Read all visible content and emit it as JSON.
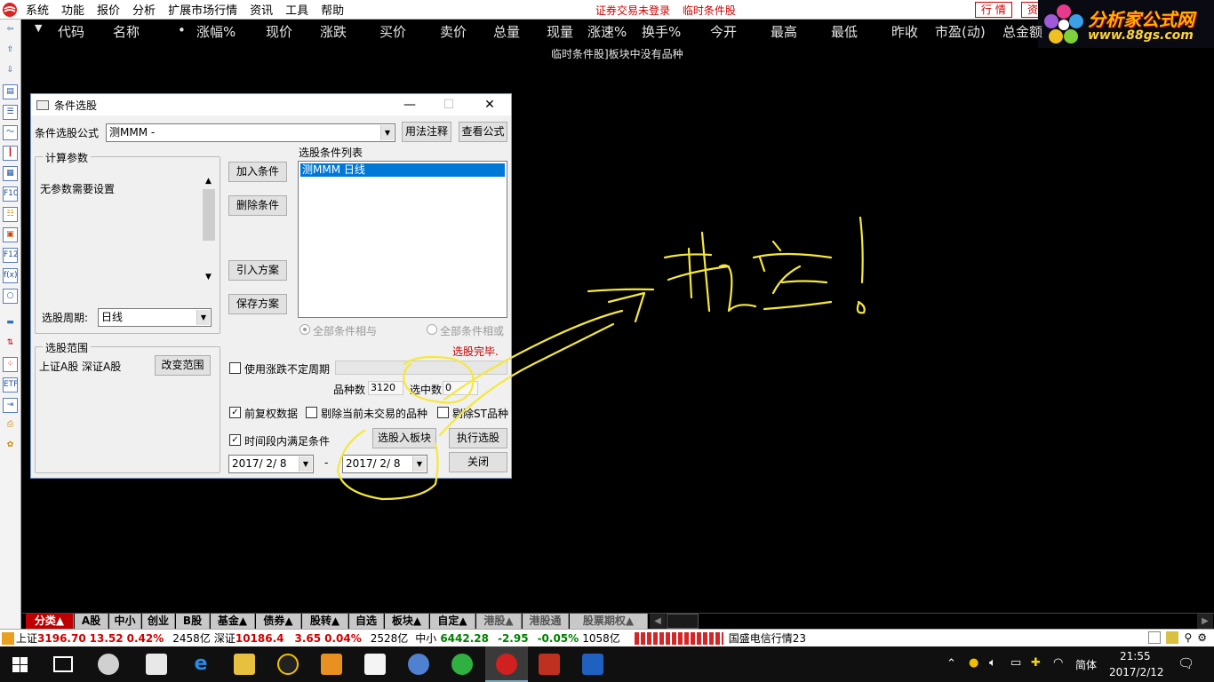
{
  "menubar": {
    "items": [
      "系统",
      "功能",
      "报价",
      "分析",
      "扩展市场行情",
      "资讯",
      "工具",
      "帮助"
    ],
    "status_login": "证券交易未登录",
    "status_block": "临时条件股",
    "btn_quote": "行 情",
    "btn_info": "资"
  },
  "brand": {
    "name": "分析家公式网",
    "url": "www.88gs.com"
  },
  "columns": {
    "arrow": "▼",
    "dot": "•",
    "labels": [
      "代码",
      "名称",
      "涨幅%",
      "现价",
      "涨跌",
      "买价",
      "卖价",
      "总量",
      "现量",
      "涨速%",
      "换手%",
      "今开",
      "最高",
      "最低",
      "昨收",
      "市盈(动)",
      "总金额"
    ]
  },
  "notice": "临时条件股]板块中没有品种",
  "dialog": {
    "title": "条件选股",
    "formula_label": "条件选股公式",
    "formula_value": "测MMM            -",
    "btn_usage": "用法注释",
    "btn_view_formula": "查看公式",
    "params_group": "计算参数",
    "params_text": "无参数需要设置",
    "period_label": "选股周期:",
    "period_value": "日线",
    "btn_add": "加入条件",
    "btn_delete": "删除条件",
    "btn_import": "引入方案",
    "btn_save": "保存方案",
    "list_title": "选股条件列表",
    "list_items": [
      "测MMM  日线"
    ],
    "radio_and": "全部条件相与",
    "radio_or": "全部条件相或",
    "done_text": "选股完毕.",
    "range_group": "选股范围",
    "range_text": "上证A股 深证A股",
    "btn_change_range": "改变范围",
    "chk_uncertain_period": "使用涨跌不定周期",
    "count_label": "品种数",
    "count_value": "3120",
    "selected_label": "选中数",
    "selected_value": "0",
    "chk_adjust": "前复权数据",
    "chk_exclude_untraded": "剔除当前未交易的品种",
    "chk_exclude_st": "剔除ST品种",
    "chk_time_range": "时间段内满足条件",
    "btn_to_block": "选股入板块",
    "btn_execute": "执行选股",
    "date_from": "2017/ 2/ 8",
    "date_sep": "-",
    "date_to": "2017/ 2/ 8",
    "btn_close": "关闭"
  },
  "bottom_tabs": [
    "分类▲",
    "A股",
    "中小",
    "创业",
    "B股",
    "基金▲",
    "债券▲",
    "股转▲",
    "自选",
    "板块▲",
    "自定▲",
    "港股▲",
    "港股通",
    "股票期权▲"
  ],
  "indexbar": {
    "sh_name": "上证",
    "sh_value": "3196.70",
    "sh_change": "13.52",
    "sh_pct": "0.42%",
    "sh_amount": "2458亿",
    "sz_name": "深证",
    "sz_value": "10186.4",
    "sz_change": "3.65",
    "sz_pct": "0.04%",
    "sz_amount": "2528亿",
    "zx_name": "中小",
    "zx_value": "6442.28",
    "zx_change": "-2.95",
    "zx_pct": "-0.05%",
    "zx_amount": "1058亿",
    "ticker": "国盛电信行情23"
  },
  "taskbar": {
    "lang": "简体",
    "time": "21:55",
    "date": "2017/2/12"
  }
}
